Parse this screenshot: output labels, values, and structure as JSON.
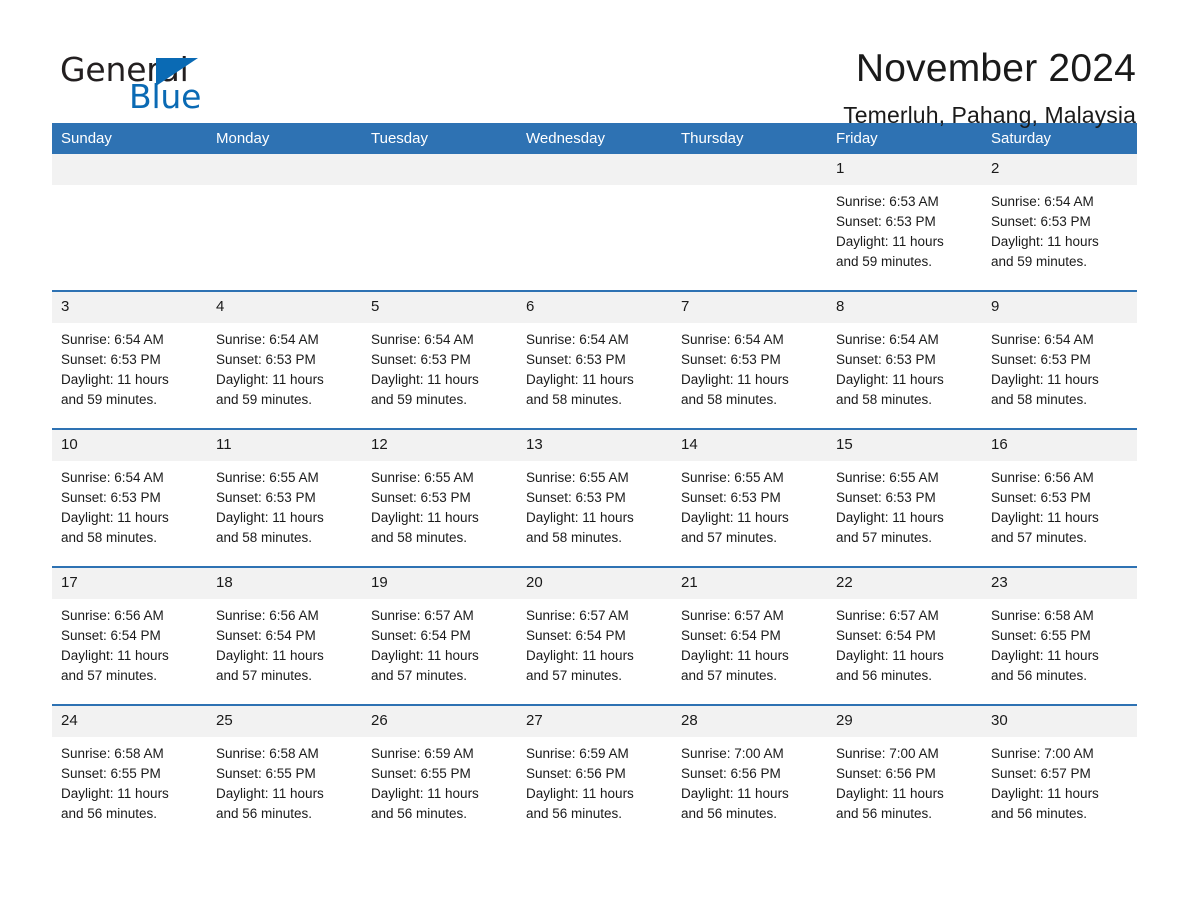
{
  "logo": {
    "word_one": "General",
    "word_two": "Blue",
    "triangle_color": "#0a6ab4"
  },
  "header": {
    "month_title": "November 2024",
    "location": "Temerluh, Pahang, Malaysia"
  },
  "theme": {
    "header_blue": "#2e72b3",
    "daynum_gray": "#f2f2f2",
    "text": "#1a1a1a"
  },
  "calendar": {
    "weekday_headers": [
      "Sunday",
      "Monday",
      "Tuesday",
      "Wednesday",
      "Thursday",
      "Friday",
      "Saturday"
    ],
    "weeks": [
      [
        {
          "day": "",
          "empty": true
        },
        {
          "day": "",
          "empty": true
        },
        {
          "day": "",
          "empty": true
        },
        {
          "day": "",
          "empty": true
        },
        {
          "day": "",
          "empty": true
        },
        {
          "day": "1",
          "sunrise": "Sunrise: 6:53 AM",
          "sunset": "Sunset: 6:53 PM",
          "daylight_line1": "Daylight: 11 hours",
          "daylight_line2": "and 59 minutes."
        },
        {
          "day": "2",
          "sunrise": "Sunrise: 6:54 AM",
          "sunset": "Sunset: 6:53 PM",
          "daylight_line1": "Daylight: 11 hours",
          "daylight_line2": "and 59 minutes."
        }
      ],
      [
        {
          "day": "3",
          "sunrise": "Sunrise: 6:54 AM",
          "sunset": "Sunset: 6:53 PM",
          "daylight_line1": "Daylight: 11 hours",
          "daylight_line2": "and 59 minutes."
        },
        {
          "day": "4",
          "sunrise": "Sunrise: 6:54 AM",
          "sunset": "Sunset: 6:53 PM",
          "daylight_line1": "Daylight: 11 hours",
          "daylight_line2": "and 59 minutes."
        },
        {
          "day": "5",
          "sunrise": "Sunrise: 6:54 AM",
          "sunset": "Sunset: 6:53 PM",
          "daylight_line1": "Daylight: 11 hours",
          "daylight_line2": "and 59 minutes."
        },
        {
          "day": "6",
          "sunrise": "Sunrise: 6:54 AM",
          "sunset": "Sunset: 6:53 PM",
          "daylight_line1": "Daylight: 11 hours",
          "daylight_line2": "and 58 minutes."
        },
        {
          "day": "7",
          "sunrise": "Sunrise: 6:54 AM",
          "sunset": "Sunset: 6:53 PM",
          "daylight_line1": "Daylight: 11 hours",
          "daylight_line2": "and 58 minutes."
        },
        {
          "day": "8",
          "sunrise": "Sunrise: 6:54 AM",
          "sunset": "Sunset: 6:53 PM",
          "daylight_line1": "Daylight: 11 hours",
          "daylight_line2": "and 58 minutes."
        },
        {
          "day": "9",
          "sunrise": "Sunrise: 6:54 AM",
          "sunset": "Sunset: 6:53 PM",
          "daylight_line1": "Daylight: 11 hours",
          "daylight_line2": "and 58 minutes."
        }
      ],
      [
        {
          "day": "10",
          "sunrise": "Sunrise: 6:54 AM",
          "sunset": "Sunset: 6:53 PM",
          "daylight_line1": "Daylight: 11 hours",
          "daylight_line2": "and 58 minutes."
        },
        {
          "day": "11",
          "sunrise": "Sunrise: 6:55 AM",
          "sunset": "Sunset: 6:53 PM",
          "daylight_line1": "Daylight: 11 hours",
          "daylight_line2": "and 58 minutes."
        },
        {
          "day": "12",
          "sunrise": "Sunrise: 6:55 AM",
          "sunset": "Sunset: 6:53 PM",
          "daylight_line1": "Daylight: 11 hours",
          "daylight_line2": "and 58 minutes."
        },
        {
          "day": "13",
          "sunrise": "Sunrise: 6:55 AM",
          "sunset": "Sunset: 6:53 PM",
          "daylight_line1": "Daylight: 11 hours",
          "daylight_line2": "and 58 minutes."
        },
        {
          "day": "14",
          "sunrise": "Sunrise: 6:55 AM",
          "sunset": "Sunset: 6:53 PM",
          "daylight_line1": "Daylight: 11 hours",
          "daylight_line2": "and 57 minutes."
        },
        {
          "day": "15",
          "sunrise": "Sunrise: 6:55 AM",
          "sunset": "Sunset: 6:53 PM",
          "daylight_line1": "Daylight: 11 hours",
          "daylight_line2": "and 57 minutes."
        },
        {
          "day": "16",
          "sunrise": "Sunrise: 6:56 AM",
          "sunset": "Sunset: 6:53 PM",
          "daylight_line1": "Daylight: 11 hours",
          "daylight_line2": "and 57 minutes."
        }
      ],
      [
        {
          "day": "17",
          "sunrise": "Sunrise: 6:56 AM",
          "sunset": "Sunset: 6:54 PM",
          "daylight_line1": "Daylight: 11 hours",
          "daylight_line2": "and 57 minutes."
        },
        {
          "day": "18",
          "sunrise": "Sunrise: 6:56 AM",
          "sunset": "Sunset: 6:54 PM",
          "daylight_line1": "Daylight: 11 hours",
          "daylight_line2": "and 57 minutes."
        },
        {
          "day": "19",
          "sunrise": "Sunrise: 6:57 AM",
          "sunset": "Sunset: 6:54 PM",
          "daylight_line1": "Daylight: 11 hours",
          "daylight_line2": "and 57 minutes."
        },
        {
          "day": "20",
          "sunrise": "Sunrise: 6:57 AM",
          "sunset": "Sunset: 6:54 PM",
          "daylight_line1": "Daylight: 11 hours",
          "daylight_line2": "and 57 minutes."
        },
        {
          "day": "21",
          "sunrise": "Sunrise: 6:57 AM",
          "sunset": "Sunset: 6:54 PM",
          "daylight_line1": "Daylight: 11 hours",
          "daylight_line2": "and 57 minutes."
        },
        {
          "day": "22",
          "sunrise": "Sunrise: 6:57 AM",
          "sunset": "Sunset: 6:54 PM",
          "daylight_line1": "Daylight: 11 hours",
          "daylight_line2": "and 56 minutes."
        },
        {
          "day": "23",
          "sunrise": "Sunrise: 6:58 AM",
          "sunset": "Sunset: 6:55 PM",
          "daylight_line1": "Daylight: 11 hours",
          "daylight_line2": "and 56 minutes."
        }
      ],
      [
        {
          "day": "24",
          "sunrise": "Sunrise: 6:58 AM",
          "sunset": "Sunset: 6:55 PM",
          "daylight_line1": "Daylight: 11 hours",
          "daylight_line2": "and 56 minutes."
        },
        {
          "day": "25",
          "sunrise": "Sunrise: 6:58 AM",
          "sunset": "Sunset: 6:55 PM",
          "daylight_line1": "Daylight: 11 hours",
          "daylight_line2": "and 56 minutes."
        },
        {
          "day": "26",
          "sunrise": "Sunrise: 6:59 AM",
          "sunset": "Sunset: 6:55 PM",
          "daylight_line1": "Daylight: 11 hours",
          "daylight_line2": "and 56 minutes."
        },
        {
          "day": "27",
          "sunrise": "Sunrise: 6:59 AM",
          "sunset": "Sunset: 6:56 PM",
          "daylight_line1": "Daylight: 11 hours",
          "daylight_line2": "and 56 minutes."
        },
        {
          "day": "28",
          "sunrise": "Sunrise: 7:00 AM",
          "sunset": "Sunset: 6:56 PM",
          "daylight_line1": "Daylight: 11 hours",
          "daylight_line2": "and 56 minutes."
        },
        {
          "day": "29",
          "sunrise": "Sunrise: 7:00 AM",
          "sunset": "Sunset: 6:56 PM",
          "daylight_line1": "Daylight: 11 hours",
          "daylight_line2": "and 56 minutes."
        },
        {
          "day": "30",
          "sunrise": "Sunrise: 7:00 AM",
          "sunset": "Sunset: 6:57 PM",
          "daylight_line1": "Daylight: 11 hours",
          "daylight_line2": "and 56 minutes."
        }
      ]
    ]
  }
}
